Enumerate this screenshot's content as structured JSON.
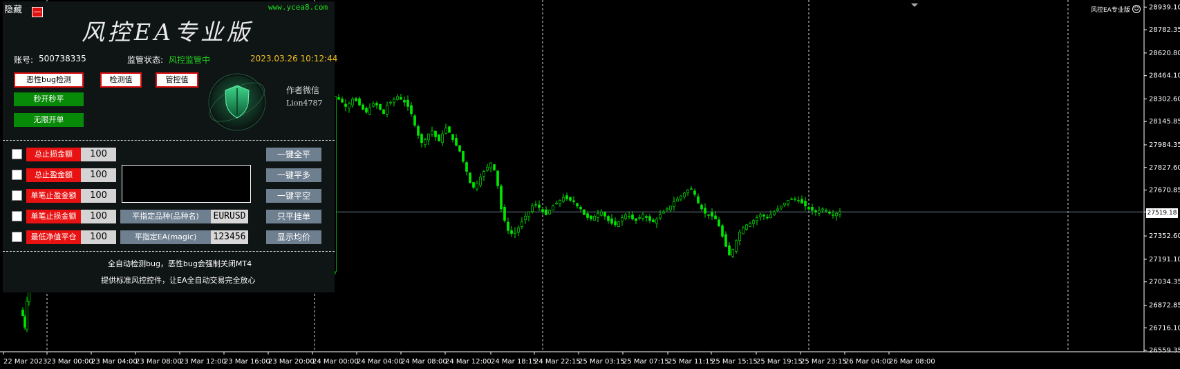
{
  "panel": {
    "hide_label": "隐藏",
    "close_symbol": "—",
    "site_url": "www.ycea8.com",
    "title": "风控EA专业版",
    "account_label": "账号:",
    "account_number": "500738335",
    "status_label": "监管状态:",
    "status_value": "风控监管中",
    "datetime": "2023.03.26 10:12:44",
    "buttons": {
      "bug_check": "恶性bug检测",
      "detect_value": "检测值",
      "control_value": "管控值",
      "instant_open_close": "秒开秒平",
      "unlimited_orders": "无限开单"
    },
    "author_label": "作者微信",
    "author_wechat": "Lion4787",
    "rows": [
      {
        "label": "总止损金额",
        "value": "100",
        "action": "一键全平"
      },
      {
        "label": "总止盈金额",
        "value": "100",
        "action": "一键平多"
      },
      {
        "label": "单笔止盈金额",
        "value": "100",
        "action": "一键平空"
      },
      {
        "label": "单笔止损金额",
        "value": "100",
        "action": "只平挂单"
      },
      {
        "label": "最低净值平仓",
        "value": "100",
        "action": "显示均价"
      }
    ],
    "close_symbol_label": "平指定品种(品种名)",
    "symbol_value": "EURUSD",
    "close_ea_label": "平指定EA(magic)",
    "magic_value": "123456",
    "footer_line1": "全自动检测bug，恶性bug会强制关闭MT4",
    "footer_line2": "提供标准风控控件，让EA全自动交易完全放心"
  },
  "chart": {
    "ea_name": "风控EA专业版",
    "current_price": "27519.18",
    "colors": {
      "candle": "#00e600",
      "background": "#000000",
      "axis_text": "#ffffff",
      "price_line": "#6b7b8b"
    }
  },
  "chart_data": {
    "type": "candlestick",
    "ylim": [
      26550,
      28950
    ],
    "y_ticks": [
      "28939.10",
      "28782.35",
      "28620.80",
      "28464.10",
      "28302.60",
      "28145.85",
      "27984.35",
      "27827.60",
      "27670.85",
      "27519.18",
      "27352.60",
      "27191.10",
      "27034.35",
      "26872.85",
      "26716.10",
      "26559.35"
    ],
    "x_ticks": [
      "22 Mar 2023",
      "23 Mar 00:00",
      "23 Mar 04:00",
      "23 Mar 08:00",
      "23 Mar 12:00",
      "23 Mar 16:00",
      "23 Mar 20:00",
      "24 Mar 00:00",
      "24 Mar 04:00",
      "24 Mar 08:00",
      "24 Mar 12:00",
      "24 Mar 18:15",
      "24 Mar 22:15",
      "25 Mar 03:15",
      "25 Mar 07:15",
      "25 Mar 11:15",
      "25 Mar 15:15",
      "25 Mar 19:15",
      "25 Mar 23:15",
      "26 Mar 04:00",
      "26 Mar 08:00"
    ],
    "period_separators": [
      "23 Mar 00:00",
      "24 Mar 00:00",
      "25 Mar 00:00",
      "26 Mar 00:00",
      "27 Mar 00:00"
    ],
    "close_series": [
      26800,
      26720,
      26900,
      27100,
      28320,
      28300,
      28280,
      28250,
      28270,
      28300,
      28290,
      28260,
      28230,
      28210,
      28240,
      28270,
      28260,
      28230,
      28200,
      28260,
      28280,
      28300,
      28320,
      28300,
      28280,
      28250,
      28200,
      28120,
      28050,
      28000,
      28020,
      28060,
      28080,
      28040,
      28010,
      28060,
      28100,
      28070,
      28020,
      27980,
      27940,
      27870,
      27800,
      27720,
      27690,
      27720,
      27760,
      27800,
      27830,
      27860,
      27810,
      27700,
      27540,
      27460,
      27390,
      27370,
      27380,
      27410,
      27450,
      27490,
      27520,
      27560,
      27570,
      27550,
      27520,
      27500,
      27530,
      27560,
      27580,
      27600,
      27620,
      27610,
      27600,
      27590,
      27560,
      27540,
      27500,
      27480,
      27470,
      27490,
      27510,
      27520,
      27490,
      27460,
      27440,
      27430,
      27450,
      27480,
      27500,
      27490,
      27470,
      27460,
      27480,
      27500,
      27480,
      27460,
      27450,
      27470,
      27500,
      27520,
      27540,
      27560,
      27590,
      27610,
      27630,
      27650,
      27670,
      27680,
      27640,
      27580,
      27540,
      27510,
      27500,
      27490,
      27470,
      27420,
      27350,
      27280,
      27220,
      27260,
      27320,
      27380,
      27410,
      27430,
      27440,
      27460,
      27480,
      27500,
      27490,
      27480,
      27500,
      27520,
      27540,
      27560,
      27580,
      27600,
      27610,
      27610,
      27600,
      27580,
      27560,
      27540,
      27530,
      27520,
      27530,
      27540,
      27530,
      27510,
      27500,
      27510,
      27520
    ]
  }
}
